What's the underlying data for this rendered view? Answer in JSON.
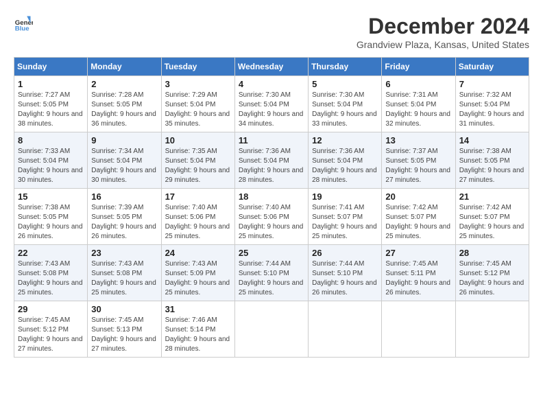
{
  "logo": {
    "line1": "General",
    "line2": "Blue"
  },
  "title": "December 2024",
  "location": "Grandview Plaza, Kansas, United States",
  "weekdays": [
    "Sunday",
    "Monday",
    "Tuesday",
    "Wednesday",
    "Thursday",
    "Friday",
    "Saturday"
  ],
  "weeks": [
    [
      {
        "day": "1",
        "sunrise": "7:27 AM",
        "sunset": "5:05 PM",
        "daylight": "9 hours and 38 minutes."
      },
      {
        "day": "2",
        "sunrise": "7:28 AM",
        "sunset": "5:05 PM",
        "daylight": "9 hours and 36 minutes."
      },
      {
        "day": "3",
        "sunrise": "7:29 AM",
        "sunset": "5:04 PM",
        "daylight": "9 hours and 35 minutes."
      },
      {
        "day": "4",
        "sunrise": "7:30 AM",
        "sunset": "5:04 PM",
        "daylight": "9 hours and 34 minutes."
      },
      {
        "day": "5",
        "sunrise": "7:30 AM",
        "sunset": "5:04 PM",
        "daylight": "9 hours and 33 minutes."
      },
      {
        "day": "6",
        "sunrise": "7:31 AM",
        "sunset": "5:04 PM",
        "daylight": "9 hours and 32 minutes."
      },
      {
        "day": "7",
        "sunrise": "7:32 AM",
        "sunset": "5:04 PM",
        "daylight": "9 hours and 31 minutes."
      }
    ],
    [
      {
        "day": "8",
        "sunrise": "7:33 AM",
        "sunset": "5:04 PM",
        "daylight": "9 hours and 30 minutes."
      },
      {
        "day": "9",
        "sunrise": "7:34 AM",
        "sunset": "5:04 PM",
        "daylight": "9 hours and 30 minutes."
      },
      {
        "day": "10",
        "sunrise": "7:35 AM",
        "sunset": "5:04 PM",
        "daylight": "9 hours and 29 minutes."
      },
      {
        "day": "11",
        "sunrise": "7:36 AM",
        "sunset": "5:04 PM",
        "daylight": "9 hours and 28 minutes."
      },
      {
        "day": "12",
        "sunrise": "7:36 AM",
        "sunset": "5:04 PM",
        "daylight": "9 hours and 28 minutes."
      },
      {
        "day": "13",
        "sunrise": "7:37 AM",
        "sunset": "5:05 PM",
        "daylight": "9 hours and 27 minutes."
      },
      {
        "day": "14",
        "sunrise": "7:38 AM",
        "sunset": "5:05 PM",
        "daylight": "9 hours and 27 minutes."
      }
    ],
    [
      {
        "day": "15",
        "sunrise": "7:38 AM",
        "sunset": "5:05 PM",
        "daylight": "9 hours and 26 minutes."
      },
      {
        "day": "16",
        "sunrise": "7:39 AM",
        "sunset": "5:05 PM",
        "daylight": "9 hours and 26 minutes."
      },
      {
        "day": "17",
        "sunrise": "7:40 AM",
        "sunset": "5:06 PM",
        "daylight": "9 hours and 25 minutes."
      },
      {
        "day": "18",
        "sunrise": "7:40 AM",
        "sunset": "5:06 PM",
        "daylight": "9 hours and 25 minutes."
      },
      {
        "day": "19",
        "sunrise": "7:41 AM",
        "sunset": "5:07 PM",
        "daylight": "9 hours and 25 minutes."
      },
      {
        "day": "20",
        "sunrise": "7:42 AM",
        "sunset": "5:07 PM",
        "daylight": "9 hours and 25 minutes."
      },
      {
        "day": "21",
        "sunrise": "7:42 AM",
        "sunset": "5:07 PM",
        "daylight": "9 hours and 25 minutes."
      }
    ],
    [
      {
        "day": "22",
        "sunrise": "7:43 AM",
        "sunset": "5:08 PM",
        "daylight": "9 hours and 25 minutes."
      },
      {
        "day": "23",
        "sunrise": "7:43 AM",
        "sunset": "5:08 PM",
        "daylight": "9 hours and 25 minutes."
      },
      {
        "day": "24",
        "sunrise": "7:43 AM",
        "sunset": "5:09 PM",
        "daylight": "9 hours and 25 minutes."
      },
      {
        "day": "25",
        "sunrise": "7:44 AM",
        "sunset": "5:10 PM",
        "daylight": "9 hours and 25 minutes."
      },
      {
        "day": "26",
        "sunrise": "7:44 AM",
        "sunset": "5:10 PM",
        "daylight": "9 hours and 26 minutes."
      },
      {
        "day": "27",
        "sunrise": "7:45 AM",
        "sunset": "5:11 PM",
        "daylight": "9 hours and 26 minutes."
      },
      {
        "day": "28",
        "sunrise": "7:45 AM",
        "sunset": "5:12 PM",
        "daylight": "9 hours and 26 minutes."
      }
    ],
    [
      {
        "day": "29",
        "sunrise": "7:45 AM",
        "sunset": "5:12 PM",
        "daylight": "9 hours and 27 minutes."
      },
      {
        "day": "30",
        "sunrise": "7:45 AM",
        "sunset": "5:13 PM",
        "daylight": "9 hours and 27 minutes."
      },
      {
        "day": "31",
        "sunrise": "7:46 AM",
        "sunset": "5:14 PM",
        "daylight": "9 hours and 28 minutes."
      },
      null,
      null,
      null,
      null
    ]
  ]
}
